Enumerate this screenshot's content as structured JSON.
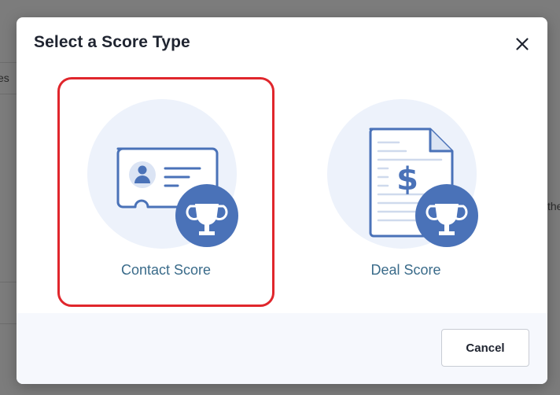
{
  "background": {
    "fragment_left": "es",
    "fragment_right": "the"
  },
  "modal": {
    "title": "Select a Score Type",
    "options": [
      {
        "label": "Contact Score",
        "selected": true
      },
      {
        "label": "Deal Score",
        "selected": false
      }
    ],
    "cancel_label": "Cancel"
  },
  "colors": {
    "accent": "#4a72b8",
    "selection_border": "#e0262c",
    "option_label": "#3a6b8a",
    "illustration_bg": "#edf2fb",
    "footer_bg": "#f6f8fd"
  },
  "icons": {
    "close": "close-icon",
    "contact": "contact-card-icon",
    "deal": "deal-document-icon",
    "trophy": "trophy-icon"
  }
}
